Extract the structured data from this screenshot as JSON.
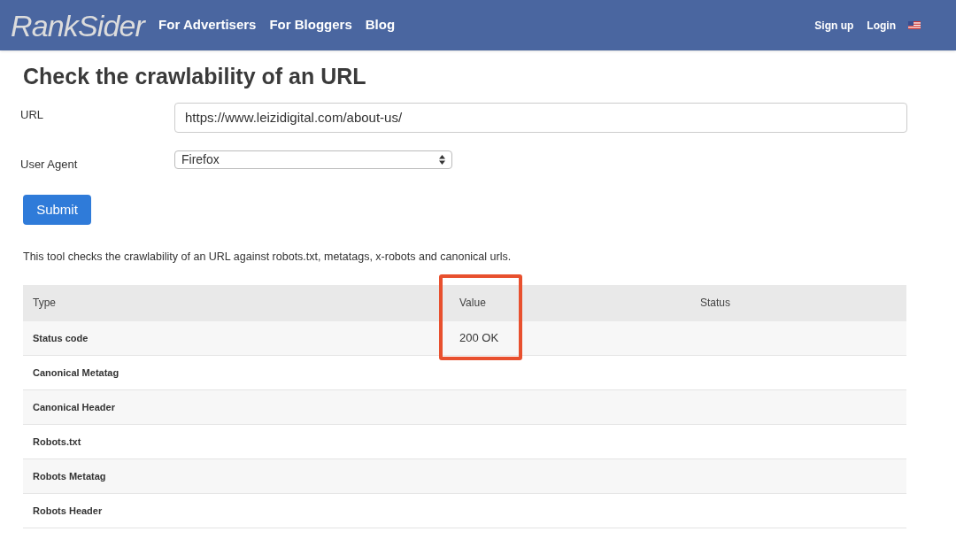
{
  "nav": {
    "logo": "RankSider",
    "links": [
      "For Advertisers",
      "For Bloggers",
      "Blog"
    ],
    "right_links": [
      "Sign up",
      "Login"
    ]
  },
  "title": "Check the crawlability of an URL",
  "form": {
    "url": {
      "label": "URL",
      "value": "https://www.leizidigital.com/about-us/"
    },
    "user_agent": {
      "label": "User Agent",
      "value": "Firefox"
    },
    "submit": "Submit"
  },
  "description": "This tool checks the crawlability of an URL against robots.txt, metatags, x-robots and canonical urls.",
  "table": {
    "columns": [
      {
        "label": "Type",
        "highlighted": false
      },
      {
        "label": "Value",
        "highlighted": true
      },
      {
        "label": "Status",
        "highlighted": false
      }
    ],
    "rows": [
      [
        "Status code",
        "200 OK",
        ""
      ],
      [
        "Canonical Metatag",
        "",
        ""
      ],
      [
        "Canonical Header",
        "",
        ""
      ],
      [
        "Robots.txt",
        "",
        ""
      ],
      [
        "Robots Metatag",
        "",
        ""
      ],
      [
        "Robots Header",
        "",
        ""
      ]
    ]
  }
}
